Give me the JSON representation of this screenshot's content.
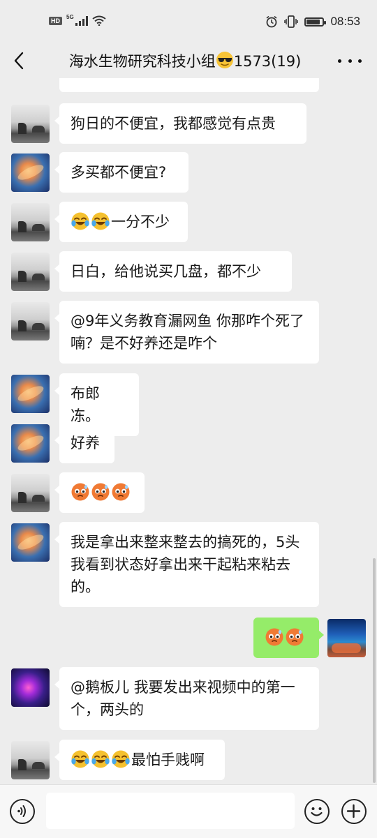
{
  "status_bar": {
    "network": "HD",
    "signal": "5G",
    "time": "08:53",
    "battery_level": 0.85,
    "icons": [
      "hd-icon",
      "signal-icon",
      "wifi-icon",
      "alarm-icon",
      "vibrate-icon",
      "battery-icon"
    ]
  },
  "header": {
    "title_before": "海水生物研究科技小组",
    "title_after": "1573(19)",
    "back_icon": "chevron-left-icon",
    "more_icon": "more-dots-icon"
  },
  "messages": [
    {
      "side": "left",
      "avatar": "lake",
      "text": "狗日的不便宜，我都感觉有点贵",
      "emojis": []
    },
    {
      "side": "left",
      "avatar": "coral",
      "text": "多买都不便宜?",
      "emojis": []
    },
    {
      "side": "left",
      "avatar": "lake",
      "text": "一分不少",
      "emojis": [
        "laugh-cry",
        "laugh-cry"
      ]
    },
    {
      "side": "left",
      "avatar": "lake",
      "text": "日白，给他说买几盘，都不少",
      "emojis": []
    },
    {
      "side": "left",
      "avatar": "lake",
      "text": "@9年义务教育漏网鱼  你那咋个死了喃？是不好养还是咋个",
      "emojis": []
    },
    {
      "side": "left",
      "avatar": "coral",
      "text": "布郎冻。",
      "emojis": []
    },
    {
      "side": "left",
      "avatar": "coral",
      "text": "好养",
      "emojis": []
    },
    {
      "side": "left",
      "avatar": "lake",
      "text": "",
      "emojis": [
        "blush",
        "blush",
        "blush"
      ]
    },
    {
      "side": "left",
      "avatar": "coral",
      "text": "我是拿出来整来整去的搞死的，5头我看到状态好拿出来干起粘来粘去的。",
      "emojis": []
    },
    {
      "side": "right",
      "avatar": "aquarium",
      "text": "",
      "emojis": [
        "blush",
        "blush"
      ]
    },
    {
      "side": "left",
      "avatar": "purple",
      "text": "@鹅板儿  我要发出来视频中的第一个，两头的",
      "emojis": []
    },
    {
      "side": "left",
      "avatar": "lake",
      "text": "最怕手贱啊",
      "emojis": [
        "laugh-cry",
        "laugh-cry",
        "laugh-cry"
      ]
    }
  ],
  "input_bar": {
    "voice_icon": "voice-icon",
    "emoji_icon": "smile-icon",
    "plus_icon": "plus-icon",
    "input_value": ""
  },
  "colors": {
    "background": "#ededed",
    "bubble_left": "#ffffff",
    "bubble_right": "#95ec69",
    "input_bar": "#f7f7f7"
  }
}
